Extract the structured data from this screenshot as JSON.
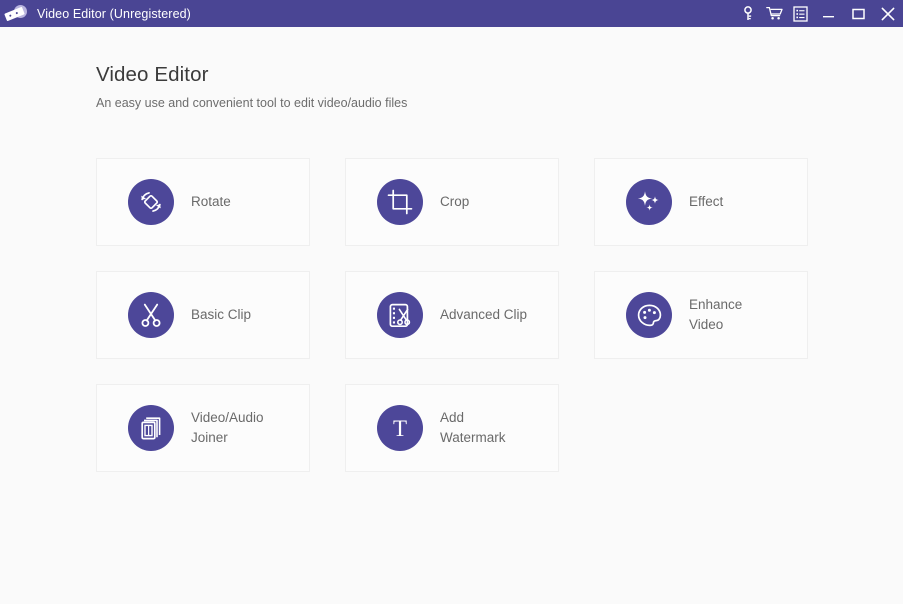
{
  "window": {
    "title": "Video Editor (Unregistered)",
    "logo_icon": "film-strip-logo-icon",
    "actions": [
      {
        "name": "register-key-button",
        "icon": "key-icon"
      },
      {
        "name": "purchase-button",
        "icon": "shopping-cart-icon"
      },
      {
        "name": "menu-button",
        "icon": "list-menu-icon"
      },
      {
        "name": "minimize-button",
        "icon": "minimize-icon"
      },
      {
        "name": "maximize-button",
        "icon": "maximize-icon"
      },
      {
        "name": "close-button",
        "icon": "close-icon"
      }
    ]
  },
  "header": {
    "title": "Video Editor",
    "subtitle": "An easy use and convenient tool to edit video/audio files"
  },
  "colors": {
    "titlebar": "#4a4594",
    "icon_circle": "#4d4799",
    "page_background": "#fafafa",
    "card_background": "#fcfcfc",
    "card_border": "#efefef",
    "label_text": "#6a6a6a",
    "title_text": "#3b3b3b",
    "subtitle_text": "#6d6d6d"
  },
  "tools": [
    {
      "label": "Rotate",
      "icon": "rotate-icon"
    },
    {
      "label": "Crop",
      "icon": "crop-icon"
    },
    {
      "label": "Effect",
      "icon": "sparkle-effect-icon"
    },
    {
      "label": "Basic Clip",
      "icon": "scissors-icon"
    },
    {
      "label": "Advanced Clip",
      "icon": "film-scissors-icon"
    },
    {
      "label": "Enhance\nVideo",
      "icon": "palette-icon"
    },
    {
      "label": "Video/Audio\nJoiner",
      "icon": "stacked-film-icon"
    },
    {
      "label": "Add\nWatermark",
      "icon": "watermark-text-icon"
    }
  ]
}
